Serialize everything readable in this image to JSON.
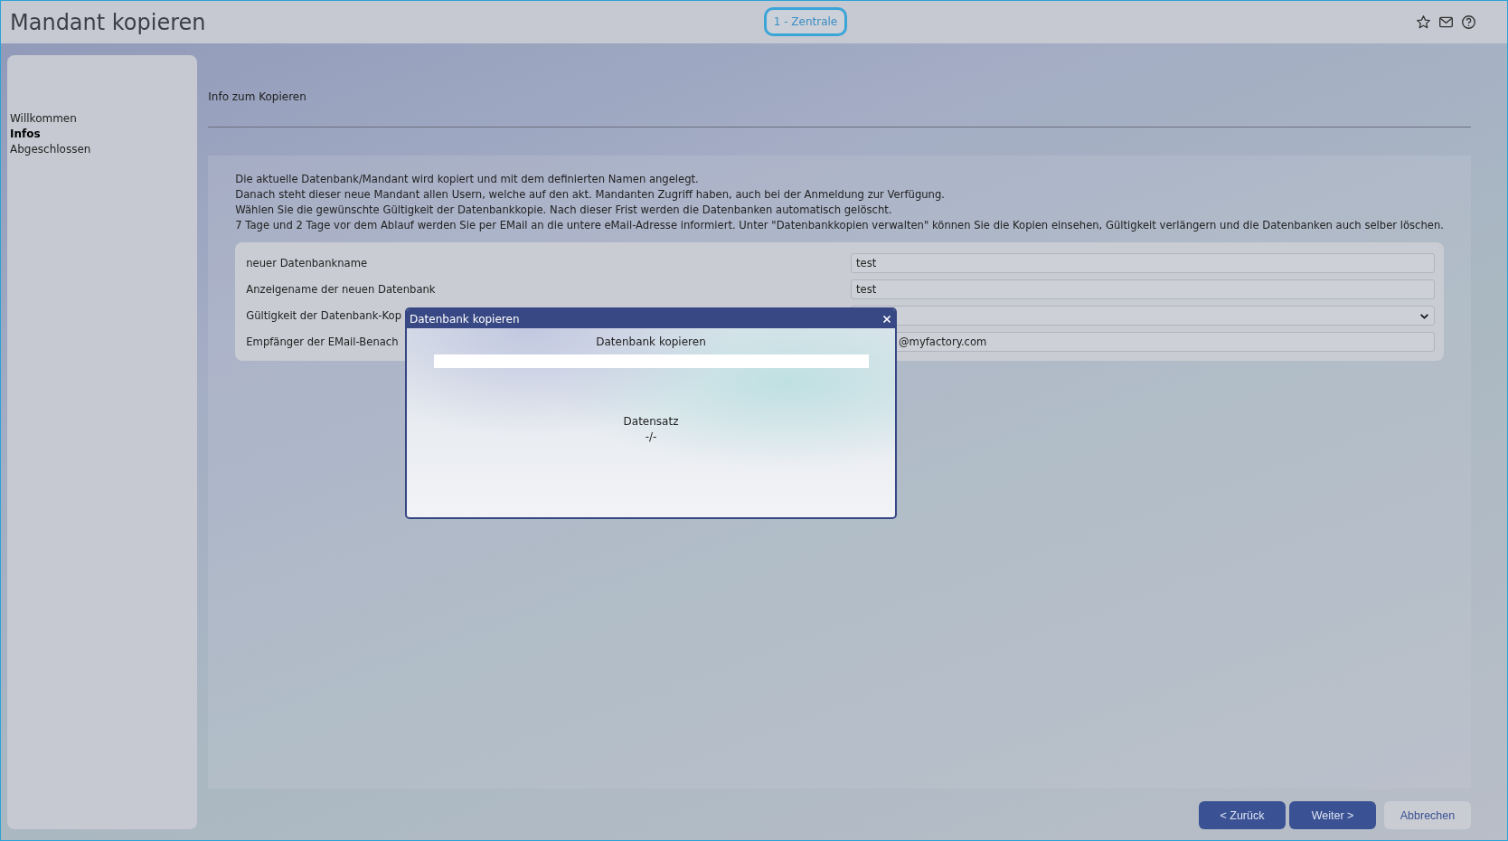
{
  "header": {
    "title": "Mandant kopieren",
    "tenant_button": "1 - Zentrale"
  },
  "sidebar": {
    "items": [
      {
        "label": "Willkommen",
        "selected": false
      },
      {
        "label": "Infos",
        "selected": true
      },
      {
        "label": "Abgeschlossen",
        "selected": false
      }
    ]
  },
  "section_title": "Info zum Kopieren",
  "info_lines": [
    "Die aktuelle Datenbank/Mandant wird kopiert und mit dem definierten Namen angelegt.",
    "Danach steht dieser neue Mandant allen Usern, welche auf den akt. Mandanten Zugriff haben, auch bei der Anmeldung zur Verfügung.",
    "Wählen Sie die gewünschte Gültigkeit der Datenbankkopie. Nach dieser Frist werden die Datenbanken automatisch gelöscht.",
    "7 Tage und 2 Tage vor dem Ablauf werden Sie per EMail an die untere eMail-Adresse informiert. Unter \"Datenbankkopien verwalten\" können Sie die Kopien einsehen, Gültigkeit verlängern und die Datenbanken auch selber löschen."
  ],
  "form": {
    "fields": [
      {
        "label": "neuer Datenbankname",
        "kind": "text",
        "value": "test"
      },
      {
        "label": "Anzeigename der neuen Datenbank",
        "kind": "text",
        "value": "test"
      },
      {
        "label": "Gültigkeit der Datenbank-Kop",
        "kind": "select"
      },
      {
        "label": "Empfänger der EMail-Benach",
        "kind": "covered",
        "value": "@myfactory.com"
      }
    ]
  },
  "buttons": [
    {
      "label": "< Zurück",
      "kind": "primary"
    },
    {
      "label": "Weiter >",
      "kind": "primary"
    },
    {
      "label": "Abbrechen",
      "kind": "secondary"
    }
  ],
  "dialog": {
    "title": "Datenbank kopieren",
    "heading": "Datenbank kopieren",
    "progress": {
      "level": 0
    },
    "record_label": "Datensatz",
    "record_value": "-/-"
  }
}
